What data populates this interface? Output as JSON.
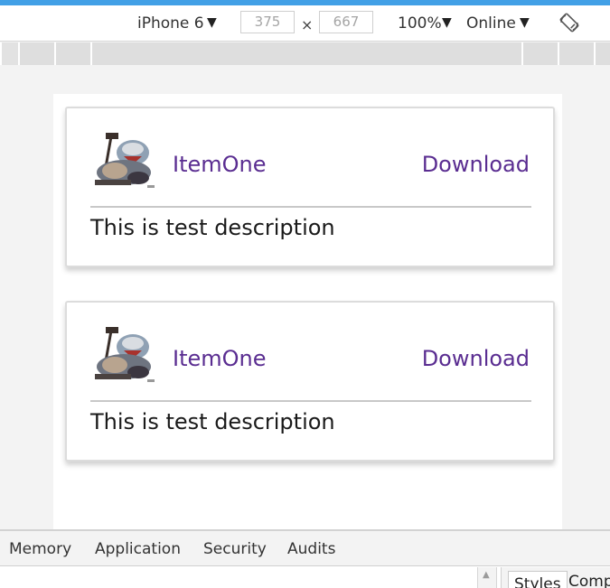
{
  "toolbar": {
    "device": "iPhone 6",
    "width": "375",
    "height": "667",
    "times": "×",
    "zoom": "100%",
    "network": "Online"
  },
  "cards": [
    {
      "title": "ItemOne",
      "action": "Download",
      "description": "This is test description"
    },
    {
      "title": "ItemOne",
      "action": "Download",
      "description": "This is test description"
    }
  ],
  "devtools": {
    "tabs": [
      "Memory",
      "Application",
      "Security",
      "Audits"
    ],
    "side_tabs": [
      "Styles",
      "Comp"
    ]
  },
  "colors": {
    "accent": "#5a2d91",
    "top_strip": "#42a0e6"
  }
}
